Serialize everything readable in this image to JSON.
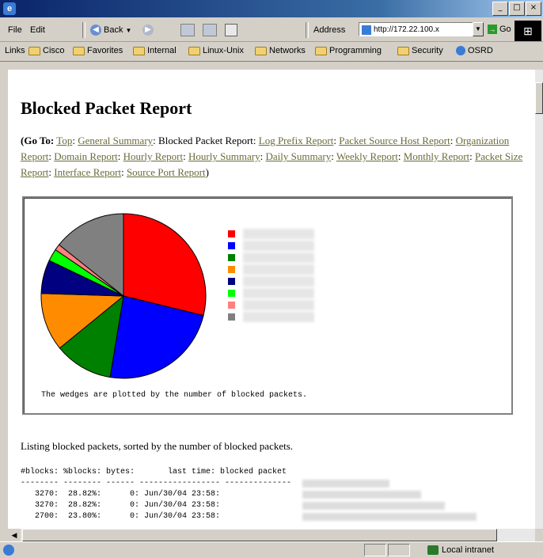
{
  "window": {
    "close_glyph": "×",
    "min_glyph": "_",
    "max_glyph": "□"
  },
  "menu": {
    "file": "File",
    "edit": "Edit"
  },
  "toolbar": {
    "back_label": "Back",
    "address_label": "Address",
    "address_value": "http://172.22.100.x",
    "go_label": "Go"
  },
  "links": {
    "label": "Links",
    "items": [
      "Cisco",
      "Favorites",
      "Internal",
      "Linux-Unix",
      "Networks",
      "Programming",
      "Security",
      "OSRD"
    ]
  },
  "page": {
    "title": "Blocked Packet Report",
    "goto_prefix": "(Go To:",
    "nav_links": [
      "Top",
      "General Summary",
      "Log Prefix Report",
      "Packet Source Host Report",
      "Organization Report",
      "Domain Report",
      "Hourly Report",
      "Hourly Summary",
      "Daily Summary",
      "Weekly Report",
      "Monthly Report",
      "Packet Size Report",
      "Interface Report",
      "Source Port Report"
    ],
    "current": "Blocked Packet Report",
    "chart_note": "The wedges are plotted by the number of blocked packets.",
    "listing_intro": "Listing blocked packets, sorted by the number of blocked packets.",
    "table": {
      "header": "#blocks: %blocks: bytes:       last time: blocked packet",
      "divider": "-------- -------- ------ ----------------- --------------",
      "rows": [
        "   3270:  28.82%:      0: Jun/30/04 23:58:",
        "   3270:  28.82%:      0: Jun/30/04 23:58:",
        "   2700:  23.80%:      0: Jun/30/04 23:58:"
      ]
    }
  },
  "chart_data": {
    "type": "pie",
    "values": [
      28.8,
      23.8,
      11.5,
      11.4,
      6.6,
      2.4,
      1.2,
      14.3
    ],
    "colors": [
      "#ff0000",
      "#0000ff",
      "#008000",
      "#ff8c00",
      "#000080",
      "#00ff00",
      "#ff8080",
      "#808080"
    ]
  },
  "status": {
    "zone": "Local intranet"
  }
}
